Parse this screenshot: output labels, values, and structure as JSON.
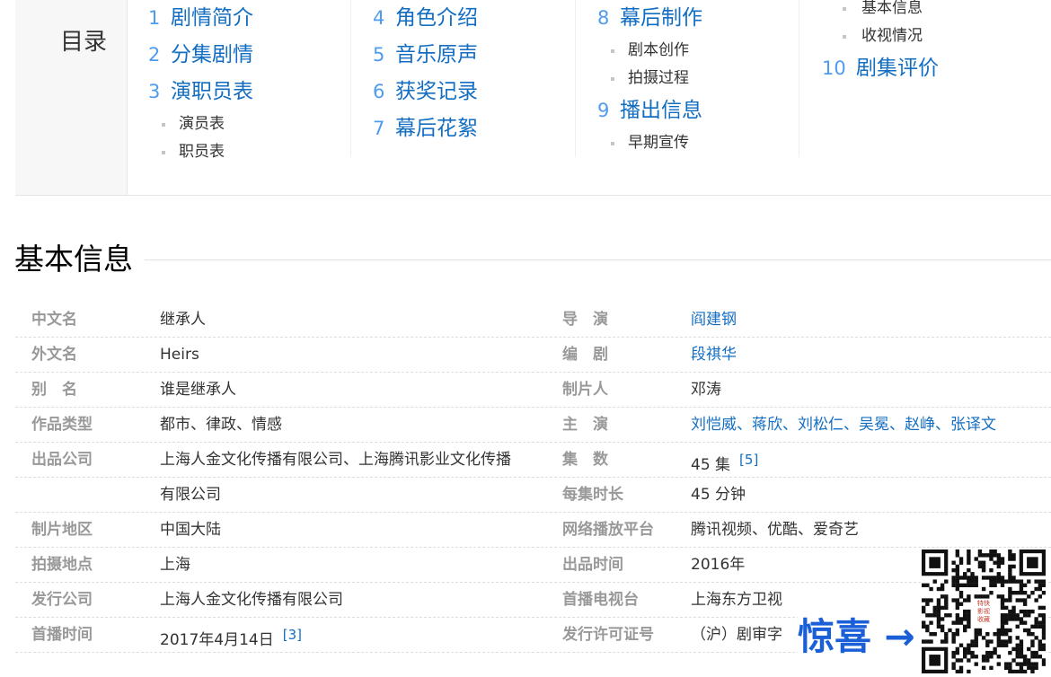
{
  "toc": {
    "title": "目录",
    "columns": [
      [
        {
          "num": "1",
          "label": "剧情简介",
          "subs": []
        },
        {
          "num": "2",
          "label": "分集剧情",
          "subs": []
        },
        {
          "num": "3",
          "label": "演职员表",
          "subs": [
            "演员表",
            "职员表"
          ]
        }
      ],
      [
        {
          "num": "4",
          "label": "角色介绍",
          "subs": []
        },
        {
          "num": "5",
          "label": "音乐原声",
          "subs": []
        },
        {
          "num": "6",
          "label": "获奖记录",
          "subs": []
        },
        {
          "num": "7",
          "label": "幕后花絮",
          "subs": []
        }
      ],
      [
        {
          "num": "8",
          "label": "幕后制作",
          "subs": [
            "剧本创作",
            "拍摄过程"
          ]
        },
        {
          "num": "9",
          "label": "播出信息",
          "subs": [
            "早期宣传"
          ]
        }
      ],
      [
        {
          "num": "",
          "label": "",
          "subs": [
            "基本信息",
            "收视情况"
          ]
        },
        {
          "num": "10",
          "label": "剧集评价",
          "subs": []
        }
      ]
    ]
  },
  "section": {
    "title": "基本信息"
  },
  "info": {
    "rows": [
      {
        "k1": "中文名",
        "v1": "继承人",
        "k2": "导　演",
        "v2": "阎建钢"
      },
      {
        "k1": "外文名",
        "v1": "Heirs",
        "k2": "编　剧",
        "v2": "段祺华"
      },
      {
        "k1": "别　名",
        "v1": "谁是继承人",
        "k2": "制片人",
        "v2": "邓涛"
      },
      {
        "k1": "作品类型",
        "v1": "都市、律政、情感",
        "k2": "主　演",
        "v2": "刘恺威、蒋欣、刘松仁、吴冕、赵峥、张译文"
      },
      {
        "k1": "出品公司",
        "v1": "上海人金文化传播有限公司、上海腾讯影业文化传播",
        "k2": "集　数",
        "v2": "45 集",
        "v2_sup": "[5]"
      },
      {
        "k1": "",
        "v1": "有限公司",
        "k2": "每集时长",
        "v2": "45 分钟"
      },
      {
        "k1": "制片地区",
        "v1": "中国大陆",
        "k2": "网络播放平台",
        "v2": "腾讯视频、优酷、爱奇艺"
      },
      {
        "k1": "拍摄地点",
        "v1": "上海",
        "k2": "出品时间",
        "v2": "2016年"
      },
      {
        "k1": "发行公司",
        "v1": "上海人金文化传播有限公司",
        "k2": "首播电视台",
        "v2": "上海东方卫视"
      },
      {
        "k1": "首播时间",
        "v1": "2017年4月14日",
        "v1_sup": "[3]",
        "k2": "发行许可证号",
        "v2": "（沪）剧审字"
      }
    ]
  },
  "promo": {
    "text": "惊喜 →",
    "stamp": "特快影视收藏"
  },
  "colors": {
    "link": "#136ec2",
    "num": "#4f9cee",
    "promo": "#1a5fd8",
    "key": "#999999"
  }
}
